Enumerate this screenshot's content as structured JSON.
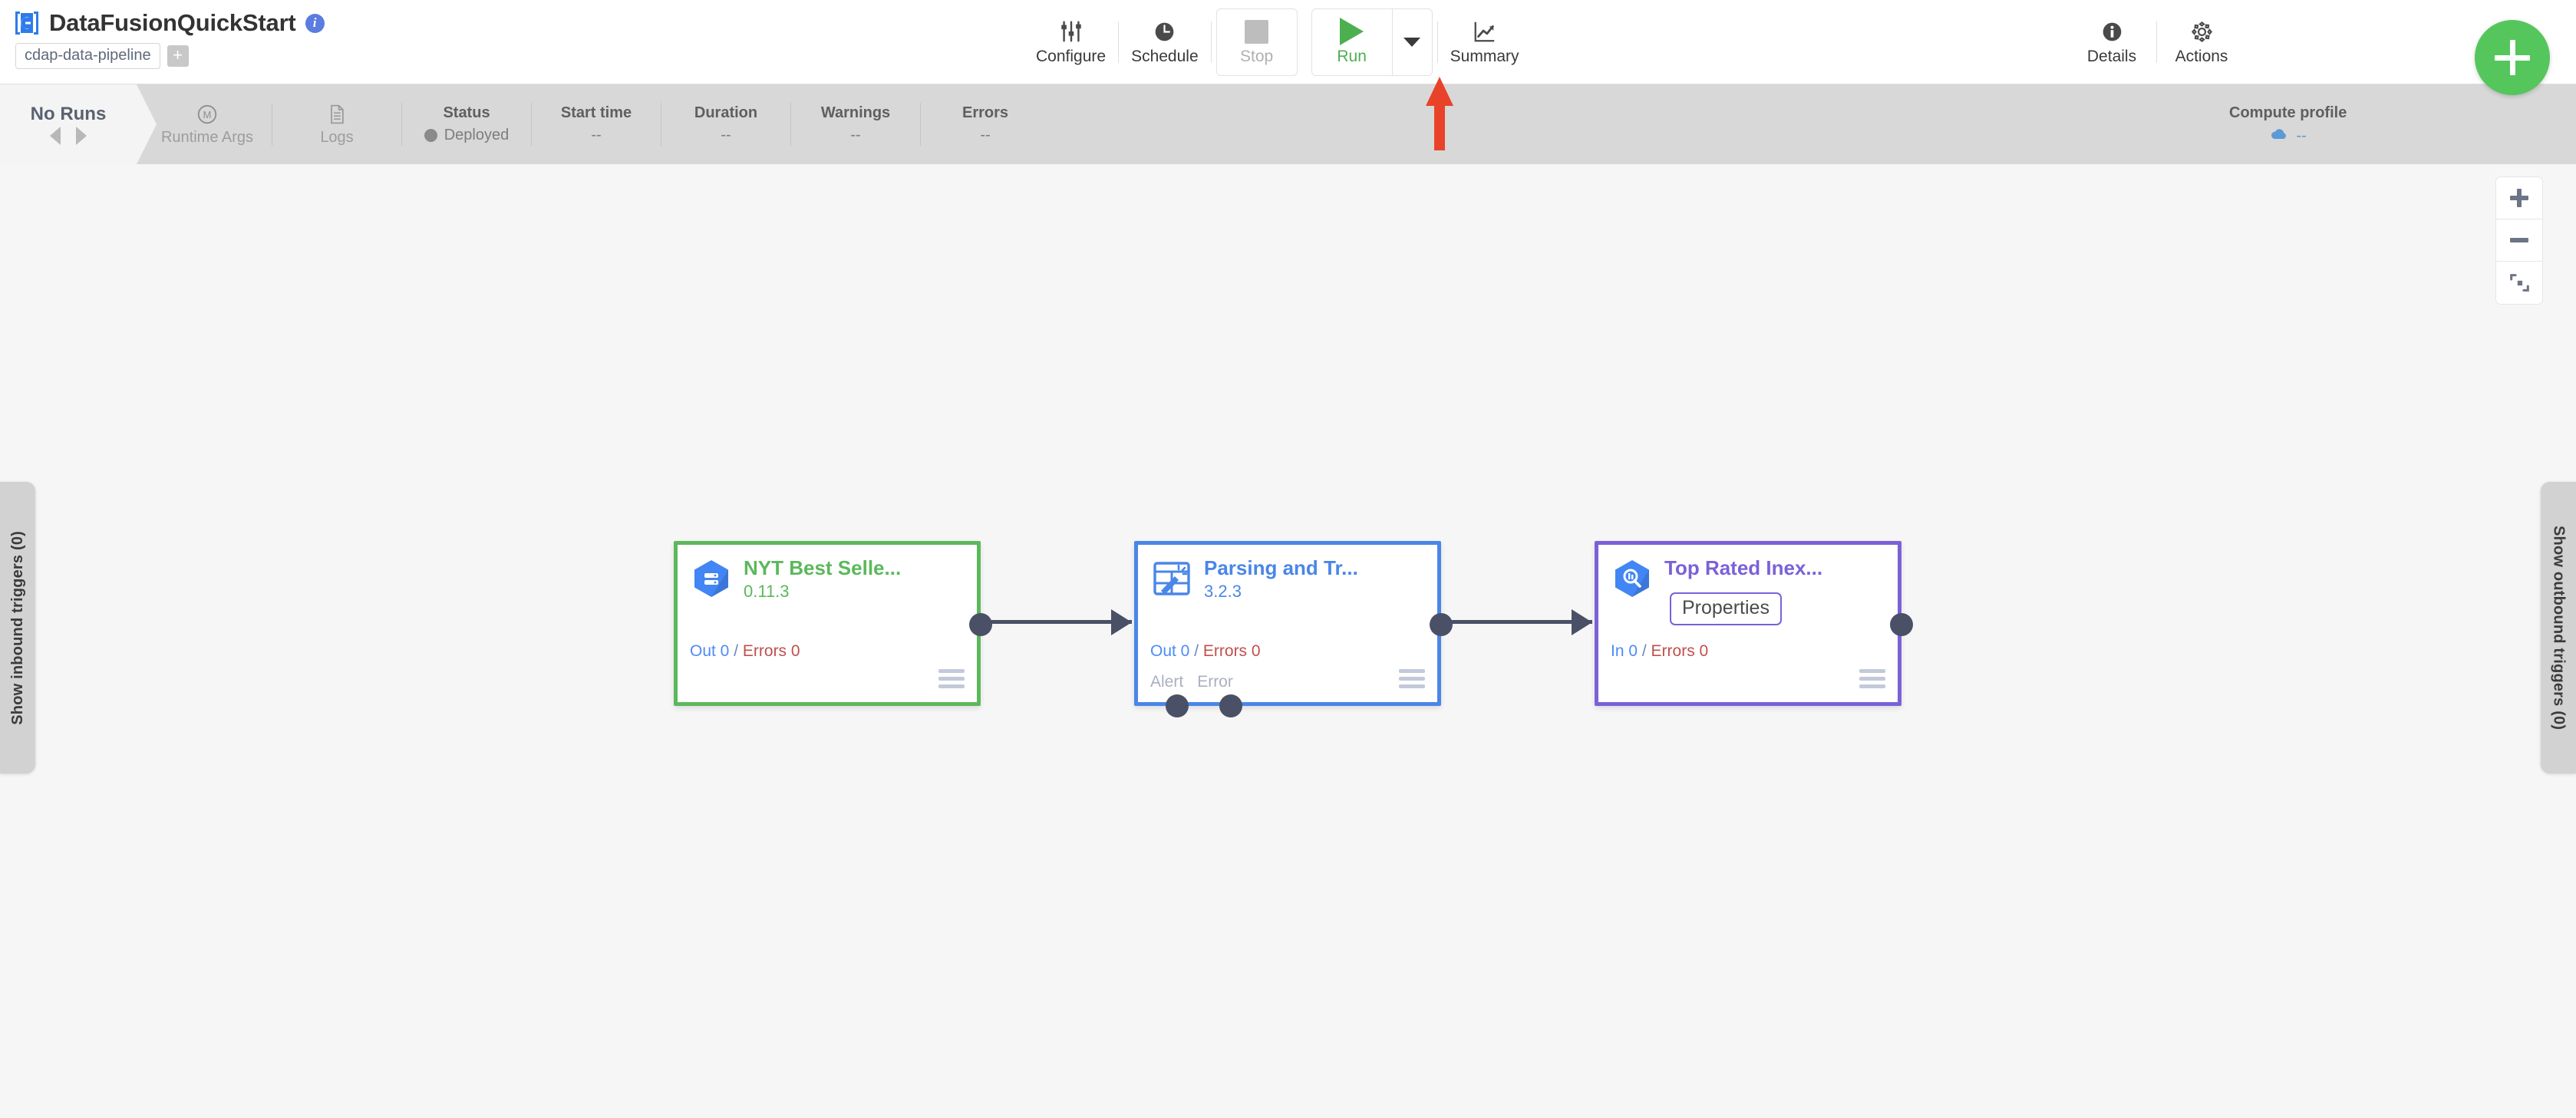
{
  "header": {
    "logo_icon": "cdap-logo-icon",
    "title": "DataFusionQuickStart",
    "info_icon": "info-icon",
    "pipeline_type": "cdap-data-pipeline",
    "add_tag_label": "+"
  },
  "toolbar": {
    "configure": {
      "label": "Configure",
      "icon": "sliders-icon"
    },
    "schedule": {
      "label": "Schedule",
      "icon": "clock-icon"
    },
    "stop": {
      "label": "Stop",
      "icon": "stop-square-icon",
      "disabled": true
    },
    "run": {
      "label": "Run",
      "icon": "play-triangle-icon",
      "accent": "#4caf50"
    },
    "run_dropdown_icon": "chevron-down-icon",
    "summary": {
      "label": "Summary",
      "icon": "trend-chart-icon"
    },
    "details": {
      "label": "Details",
      "icon": "info-circle-icon"
    },
    "actions": {
      "label": "Actions",
      "icon": "gear-icon"
    },
    "fab": {
      "label": "+",
      "icon": "plus-icon",
      "color": "#55c65c"
    }
  },
  "statusbar": {
    "runs_tab_title": "No Runs",
    "prev_icon": "triangle-left-icon",
    "next_icon": "triangle-right-icon",
    "runtime_args": {
      "label": "Runtime Args",
      "icon": "macro-m-icon"
    },
    "logs": {
      "label": "Logs",
      "icon": "document-icon"
    },
    "fields": [
      {
        "header": "Status",
        "value": "Deployed",
        "has_dot": true,
        "dot_color": "#8a8a8a"
      },
      {
        "header": "Start time",
        "value": "--",
        "has_dot": false
      },
      {
        "header": "Duration",
        "value": "--",
        "has_dot": false
      },
      {
        "header": "Warnings",
        "value": "--",
        "has_dot": false
      },
      {
        "header": "Errors",
        "value": "--",
        "has_dot": false
      }
    ],
    "compute_profile": {
      "header": "Compute profile",
      "value": "--",
      "icon": "cloud-icon"
    }
  },
  "canvas": {
    "zoom_in_icon": "plus-icon",
    "zoom_out_icon": "minus-icon",
    "fit_screen_icon": "fit-to-screen-icon",
    "left_tab_label": "Show inbound triggers (0)",
    "right_tab_label": "Show outbound triggers (0)",
    "nodes": [
      {
        "name": "NYT Best Selle...",
        "version": "0.11.3",
        "icon": "bigquery-source-icon",
        "accent": "#5cb85c",
        "metrics_prefix": "Out 0",
        "metrics_sep": " / ",
        "metrics_errors": "Errors 0",
        "port_labels": [],
        "menu_icon": "hamburger-menu-icon"
      },
      {
        "name": "Parsing and Tr...",
        "version": "3.2.3",
        "icon": "wrangler-transform-icon",
        "accent": "#4a86e8",
        "metrics_prefix": "Out 0",
        "metrics_sep": " / ",
        "metrics_errors": "Errors 0",
        "port_labels": [
          "Alert",
          "Error"
        ],
        "menu_icon": "hamburger-menu-icon"
      },
      {
        "name": "Top Rated Inex...",
        "version": "",
        "icon": "bigquery-sink-icon",
        "accent": "#7b61d8",
        "metrics_prefix": "In 0",
        "metrics_sep": " / ",
        "metrics_errors": "Errors 0",
        "port_labels": [],
        "tooltip": "Properties",
        "menu_icon": "hamburger-menu-icon"
      }
    ]
  },
  "annotation": {
    "arrow_icon": "red-up-arrow-annotation",
    "color": "#e8432a"
  }
}
